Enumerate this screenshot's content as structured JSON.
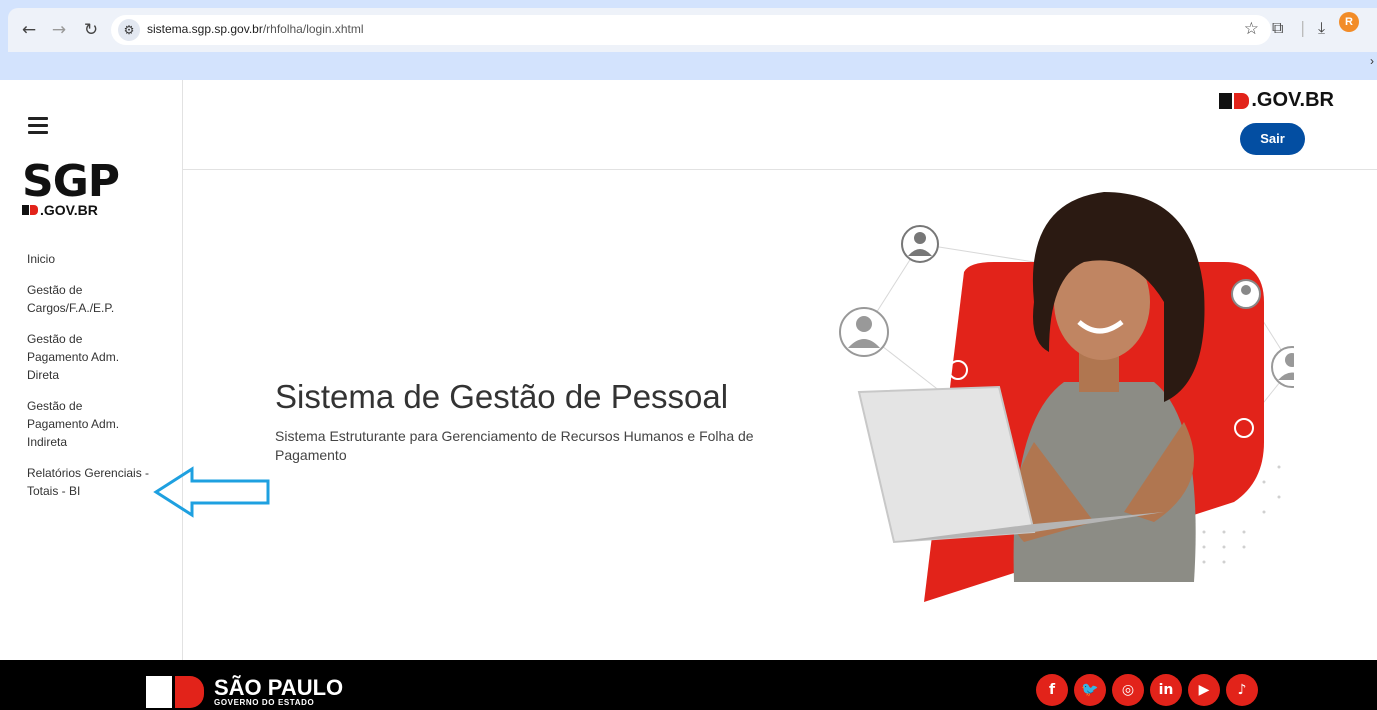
{
  "browser": {
    "url_host": "sistema.sgp.sp.gov.br",
    "url_path": "/rhfolha/login.xhtml",
    "profile_initial": "R"
  },
  "sidebar": {
    "logo_main": "SGP",
    "logo_sub": ".GOV.BR",
    "items": [
      {
        "label": "Inicio"
      },
      {
        "label": "Gestão de Cargos/F.A./E.P."
      },
      {
        "label": "Gestão de Pagamento Adm. Direta"
      },
      {
        "label": "Gestão de Pagamento Adm. Indireta"
      },
      {
        "label": "Relatórios Gerenciais - Totais - BI"
      }
    ]
  },
  "header": {
    "brand": ".GOV.BR",
    "logout_label": "Sair"
  },
  "hero": {
    "title": "Sistema de Gestão de Pessoal",
    "subtitle": "Sistema Estruturante para Gerenciamento de Recursos Humanos e Folha de Pagamento"
  },
  "footer": {
    "state_name": "SÃO PAULO",
    "state_sub": "GOVERNO DO ESTADO",
    "socials": [
      {
        "icon": "facebook-icon",
        "glyph": "f"
      },
      {
        "icon": "twitter-icon",
        "glyph": "🐦"
      },
      {
        "icon": "instagram-icon",
        "glyph": "◎"
      },
      {
        "icon": "linkedin-icon",
        "glyph": "in"
      },
      {
        "icon": "youtube-icon",
        "glyph": "▶"
      },
      {
        "icon": "tiktok-icon",
        "glyph": "♪"
      }
    ]
  },
  "colors": {
    "brand_blue": "#034ea2",
    "brand_red": "#e2231a",
    "annotation_arrow": "#1ea0e0"
  }
}
